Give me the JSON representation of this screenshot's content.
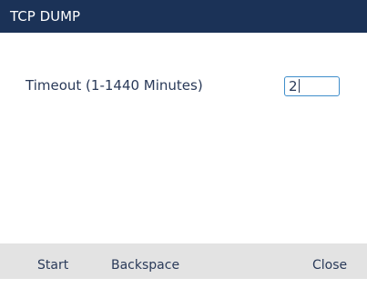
{
  "title": "TCP DUMP",
  "timeout_field": {
    "label": "Timeout (1-1440 Minutes)",
    "value": "2"
  },
  "softkeys": {
    "start": "Start",
    "backspace": "Backspace",
    "close": "Close"
  },
  "colors": {
    "title_bar": "#1b3257",
    "input_border": "#3f8ecb",
    "softkey_bar": "#e3e3e3",
    "text": "#2a3a59"
  }
}
